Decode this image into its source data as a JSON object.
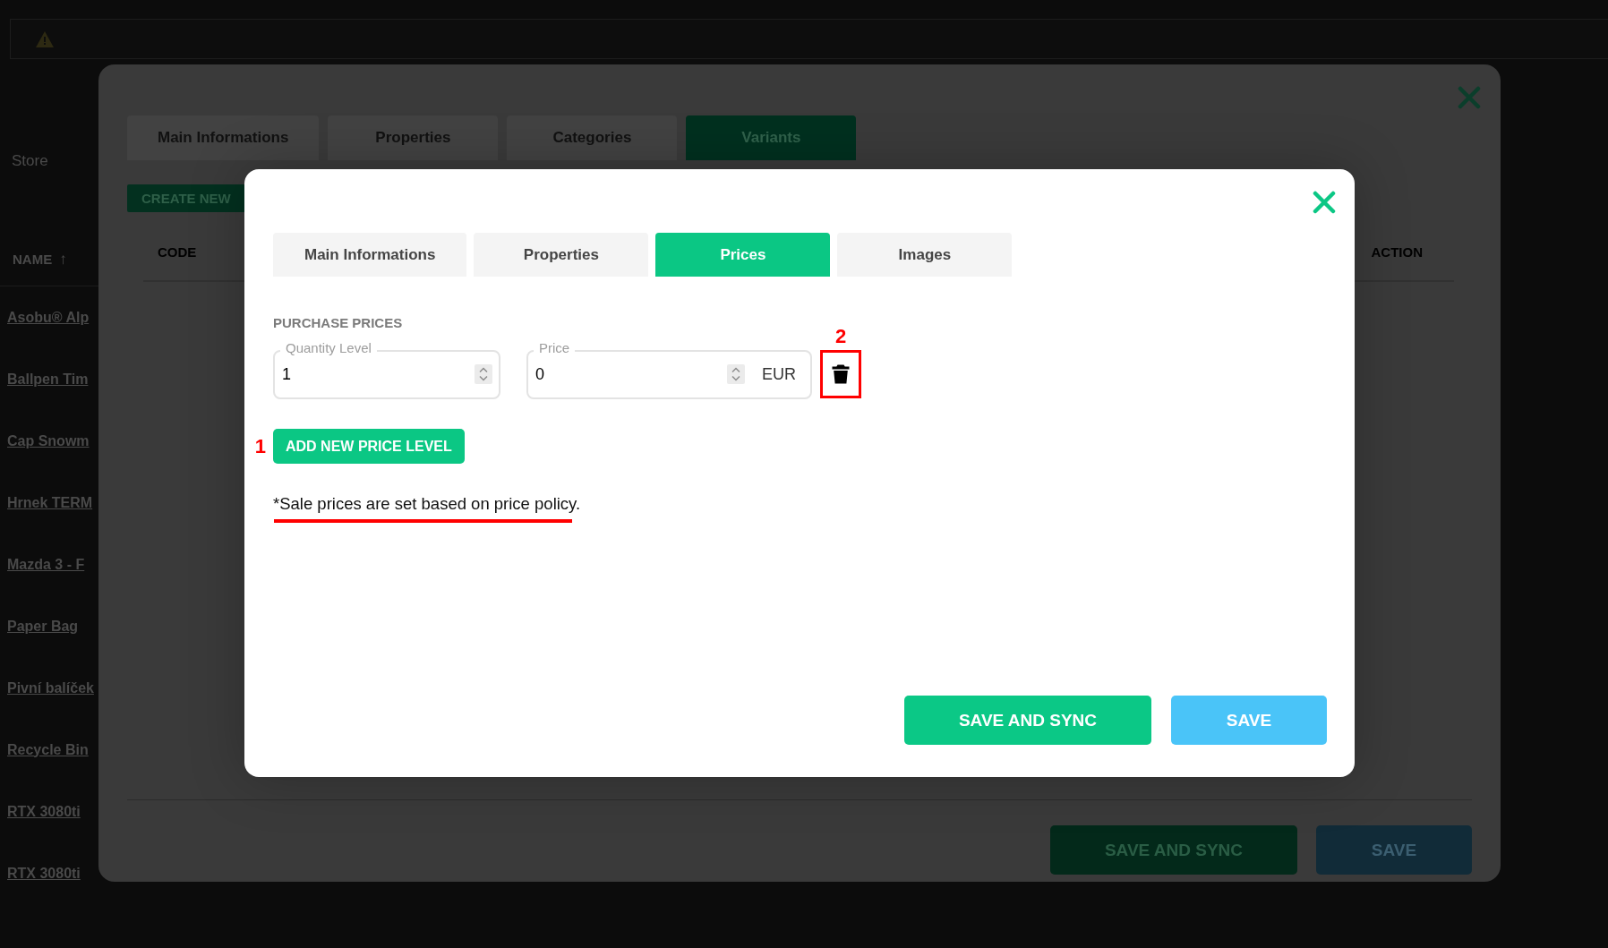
{
  "store_filter": {
    "label": "Store"
  },
  "product_list": {
    "header": "NAME",
    "sort_indicator": "↑",
    "items": [
      "Asobu® Alp",
      "Ballpen Tim",
      "Cap Snowm",
      "Hrnek TERM",
      "Mazda 3 - F",
      "Paper Bag",
      "Pivní balíček",
      "Recycle Bin",
      "RTX 3080ti",
      "RTX 3080ti"
    ]
  },
  "product_dialog": {
    "tabs": [
      {
        "label": "Main Informations",
        "selected": false
      },
      {
        "label": "Properties",
        "selected": false
      },
      {
        "label": "Categories",
        "selected": false
      },
      {
        "label": "Variants",
        "selected": true
      }
    ],
    "create_button": "CREATE NEW",
    "columns": [
      "CODE",
      "ACTION"
    ],
    "buttons": [
      {
        "label": "SAVE AND SYNC",
        "kind": "sync"
      },
      {
        "label": "SAVE",
        "kind": "save"
      }
    ]
  },
  "price_dialog": {
    "tabs": [
      {
        "label": "Main Informations",
        "selected": false
      },
      {
        "label": "Properties",
        "selected": false
      },
      {
        "label": "Prices",
        "selected": true
      },
      {
        "label": "Images",
        "selected": false
      }
    ],
    "section_title": "PURCHASE PRICES",
    "price_levels": [
      {
        "quantity_label": "Quantity Level",
        "quantity": "1",
        "price_label": "Price",
        "price": "0",
        "currency": "EUR",
        "delete_highlighted": true,
        "delete_annotation": "2"
      }
    ],
    "add_button": {
      "label": "ADD NEW PRICE LEVEL",
      "annotation": "1"
    },
    "note": {
      "text": "*Sale prices are set based on price policy.",
      "underlined": true
    },
    "buttons": [
      {
        "label": "SAVE AND SYNC",
        "kind": "sync"
      },
      {
        "label": "SAVE",
        "kind": "save"
      }
    ]
  }
}
